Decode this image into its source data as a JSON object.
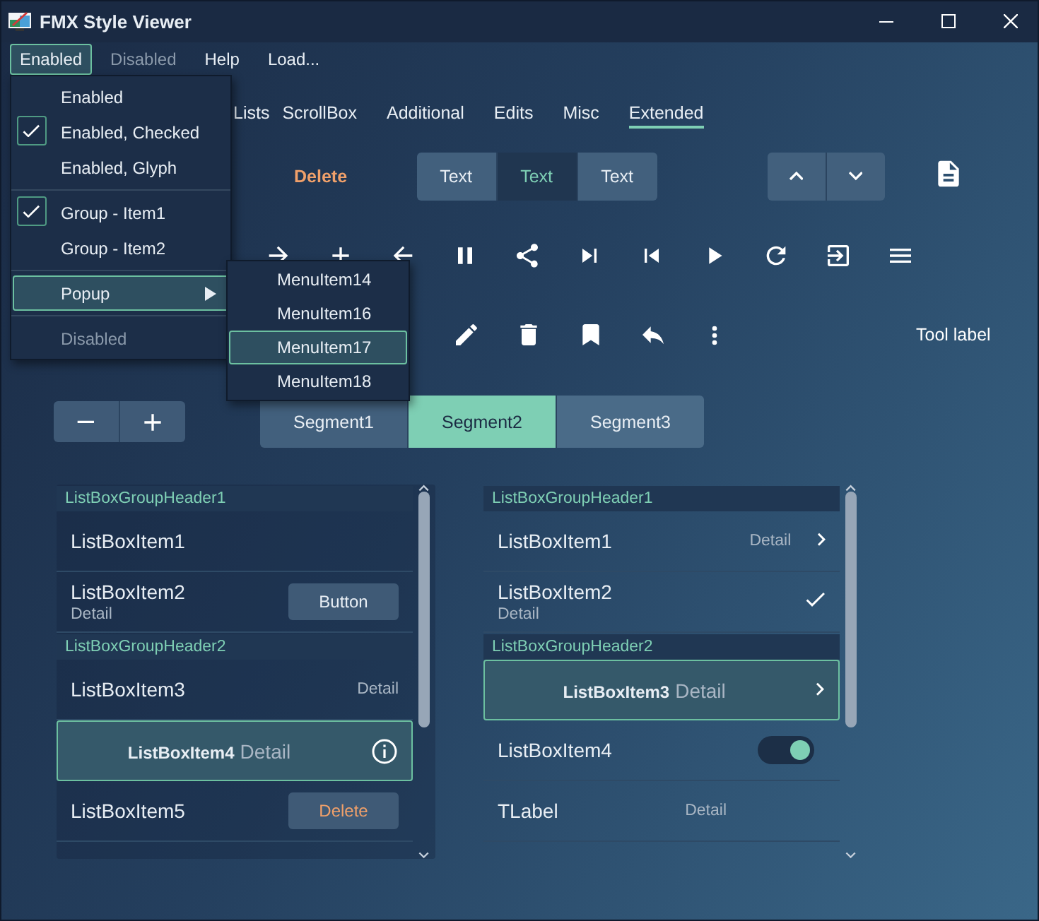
{
  "window": {
    "title": "FMX Style Viewer"
  },
  "menu_bar": [
    {
      "label": "Enabled",
      "selected": true,
      "disabled": false
    },
    {
      "label": "Disabled",
      "selected": false,
      "disabled": true
    },
    {
      "label": "Help",
      "selected": false,
      "disabled": false
    },
    {
      "label": "Load...",
      "selected": false,
      "disabled": false
    }
  ],
  "dropdown": [
    {
      "kind": "item",
      "label": "Enabled",
      "checked": false,
      "selected": false,
      "disabled": false,
      "has_submenu": false
    },
    {
      "kind": "item",
      "label": "Enabled, Checked",
      "checked": true,
      "selected": false,
      "disabled": false,
      "has_submenu": false
    },
    {
      "kind": "item",
      "label": "Enabled, Glyph",
      "checked": false,
      "selected": false,
      "disabled": false,
      "has_submenu": false
    },
    {
      "kind": "separator"
    },
    {
      "kind": "item",
      "label": "Group - Item1",
      "checked": true,
      "selected": false,
      "disabled": false,
      "has_submenu": false
    },
    {
      "kind": "item",
      "label": "Group - Item2",
      "checked": false,
      "selected": false,
      "disabled": false,
      "has_submenu": false
    },
    {
      "kind": "separator"
    },
    {
      "kind": "item",
      "label": "Popup",
      "checked": false,
      "selected": true,
      "disabled": false,
      "has_submenu": true
    },
    {
      "kind": "separator"
    },
    {
      "kind": "item",
      "label": "Disabled",
      "checked": false,
      "selected": false,
      "disabled": true,
      "has_submenu": false
    }
  ],
  "submenu": [
    {
      "label": "MenuItem14",
      "selected": false
    },
    {
      "label": "MenuItem16",
      "selected": false
    },
    {
      "label": "MenuItem17",
      "selected": true
    },
    {
      "label": "MenuItem18",
      "selected": false
    }
  ],
  "tabs": [
    {
      "label": "Lists",
      "selected": false
    },
    {
      "label": "ScrollBox",
      "selected": false
    },
    {
      "label": "Additional",
      "selected": false
    },
    {
      "label": "Edits",
      "selected": false
    },
    {
      "label": "Misc",
      "selected": false
    },
    {
      "label": "Extended",
      "selected": true
    }
  ],
  "toolbar": {
    "delete_label": "Delete",
    "text_segments": [
      {
        "label": "Text",
        "selected": false
      },
      {
        "label": "Text",
        "selected": true
      },
      {
        "label": "Text",
        "selected": false
      }
    ],
    "tool_label": "Tool label"
  },
  "segments": [
    {
      "label": "Segment1",
      "selected": false
    },
    {
      "label": "Segment2",
      "selected": true
    },
    {
      "label": "Segment3",
      "selected": false
    }
  ],
  "left_list": [
    {
      "kind": "header",
      "label": "ListBoxGroupHeader1"
    },
    {
      "kind": "plain",
      "label": "ListBoxItem1",
      "selected": false
    },
    {
      "kind": "subtitle",
      "label": "ListBoxItem2",
      "detail": "Detail",
      "selected": false,
      "accessory": {
        "kind": "button",
        "label": "Button"
      }
    },
    {
      "kind": "header",
      "label": "ListBoxGroupHeader2"
    },
    {
      "kind": "right_detail",
      "label": "ListBoxItem3",
      "detail": "Detail",
      "selected": false
    },
    {
      "kind": "inline_detail",
      "label": "ListBoxItem4",
      "detail": "Detail",
      "selected": true,
      "accessory": {
        "kind": "info"
      }
    },
    {
      "kind": "plain",
      "label": "ListBoxItem5",
      "selected": false,
      "accessory": {
        "kind": "delete_button",
        "label": "Delete"
      }
    }
  ],
  "right_list": [
    {
      "kind": "header",
      "label": "ListBoxGroupHeader1"
    },
    {
      "kind": "right_detail",
      "label": "ListBoxItem1",
      "detail": "Detail",
      "selected": false,
      "accessory": {
        "kind": "chevron"
      }
    },
    {
      "kind": "subtitle",
      "label": "ListBoxItem2",
      "detail": "Detail",
      "selected": false,
      "accessory": {
        "kind": "check"
      }
    },
    {
      "kind": "header",
      "label": "ListBoxGroupHeader2"
    },
    {
      "kind": "inline_detail",
      "label": "ListBoxItem3",
      "detail": "Detail",
      "selected": true,
      "accessory": {
        "kind": "chevron"
      }
    },
    {
      "kind": "plain",
      "label": "ListBoxItem4",
      "selected": false,
      "accessory": {
        "kind": "switch",
        "on": true
      }
    },
    {
      "kind": "mid_detail",
      "label": "TLabel",
      "detail": "Detail",
      "selected": false
    }
  ]
}
